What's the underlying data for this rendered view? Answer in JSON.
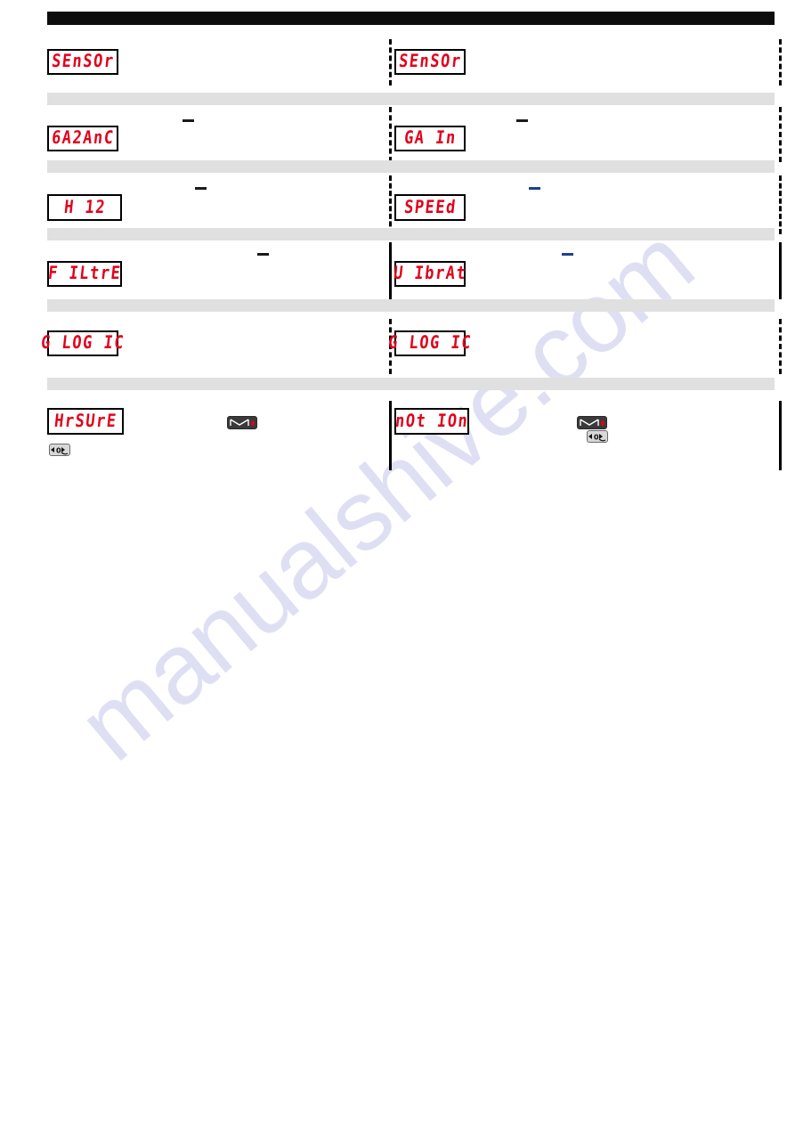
{
  "document": {
    "header_bar_color": "#0d0d0d",
    "band_color": "#e0e0e0",
    "lcd_text_color": "#e2001a",
    "watermark": "manualshive.com"
  },
  "rows": [
    {
      "id": "row-sensor",
      "left": {
        "display": "SEnSOr",
        "dash": null
      },
      "right": {
        "display": "SEnSOr",
        "dash": null,
        "divider": "dashed"
      }
    },
    {
      "id": "row-gain",
      "left": {
        "display": "6A2AnC",
        "dash": "black"
      },
      "right": {
        "display": "GA In",
        "dash": "black",
        "divider": "dashed"
      }
    },
    {
      "id": "row-speed",
      "left": {
        "display": "H 12",
        "dash": "black"
      },
      "right": {
        "display": "SPEEd",
        "dash": "blue",
        "divider": "dashed"
      }
    },
    {
      "id": "row-filter",
      "left": {
        "display": "F ILtrE",
        "dash": "black"
      },
      "right": {
        "display": "U IbrAt",
        "dash": "blue",
        "divider": "solid"
      }
    },
    {
      "id": "row-glogic",
      "left": {
        "display": "G LOG IC",
        "dash": null
      },
      "right": {
        "display": "G LOG IC",
        "dash": null,
        "divider": "dashed"
      }
    },
    {
      "id": "row-measure",
      "left": {
        "display": "HrSUrE",
        "dash": null,
        "keys": [
          "scale-key",
          "zero-key"
        ]
      },
      "right": {
        "display": "nOt IOn",
        "dash": null,
        "divider": "solid",
        "keys": [
          "scale-key",
          "zero-key"
        ]
      }
    }
  ],
  "icons": {
    "scale_key": "weighing-pan-key-icon",
    "zero_key": "zero-key-icon"
  }
}
